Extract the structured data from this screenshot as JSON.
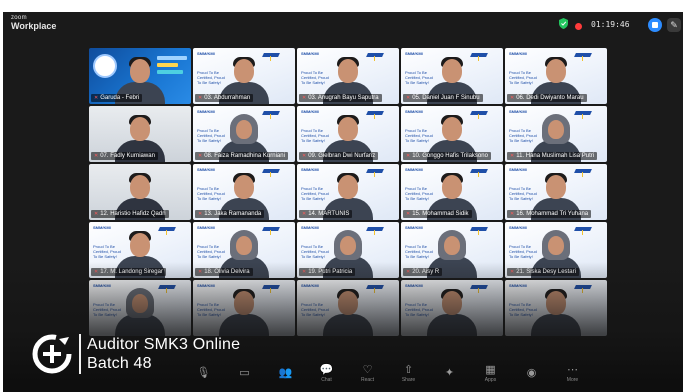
{
  "app": {
    "brand_small": "zoom",
    "brand_big": "Workplace"
  },
  "status": {
    "timer": "01:19:46"
  },
  "tile_brand": "SMM/KMI",
  "tile_slogan": "Proud To Be Certified, Proud To Be Safety!",
  "participants": [
    {
      "name": "Garuda - Febri",
      "kind": "host"
    },
    {
      "name": "03. Abdurrahman",
      "kind": "bg"
    },
    {
      "name": "03. Anugrah Bayu Saputra",
      "kind": "bg"
    },
    {
      "name": "05. Daniel Juan F Sinubu",
      "kind": "bg"
    },
    {
      "name": "06. Dedi Dwiyanto Marau",
      "kind": "bg"
    },
    {
      "name": "07. Fadly Kurniawan",
      "kind": "plain"
    },
    {
      "name": "08. Faiza Ramadhina Kurniani",
      "kind": "bg",
      "hijab": true
    },
    {
      "name": "09. Gielbran Dwi Nurfariz",
      "kind": "bg"
    },
    {
      "name": "10. Gonggo Hafis Trilaksono",
      "kind": "bg"
    },
    {
      "name": "11. Hana Muslimah Lisa Putri",
      "kind": "bg",
      "hijab": true
    },
    {
      "name": "12. Haristio Hafidz Qadri",
      "kind": "plain"
    },
    {
      "name": "13. Jaka Ramananda",
      "kind": "bg"
    },
    {
      "name": "14. MARTUNIS",
      "kind": "bg"
    },
    {
      "name": "15. Mohammad Sidik",
      "kind": "bg"
    },
    {
      "name": "16. Mohammad Tri Yuhana",
      "kind": "bg"
    },
    {
      "name": "17. M. Landong Siregar",
      "kind": "bg"
    },
    {
      "name": "18. Olivia Delvira",
      "kind": "bg",
      "hijab": true
    },
    {
      "name": "19. Putri Patricia",
      "kind": "bg",
      "hijab": true
    },
    {
      "name": "20. Aisy R",
      "kind": "bg",
      "hijab": true
    },
    {
      "name": "21. Siska Desy Lestari",
      "kind": "bg",
      "hijab": true
    },
    {
      "name": "",
      "kind": "bg",
      "hijab": true
    },
    {
      "name": "",
      "kind": "bg"
    },
    {
      "name": "",
      "kind": "bg"
    },
    {
      "name": "",
      "kind": "bg"
    },
    {
      "name": "",
      "kind": "bg"
    }
  ],
  "toolbar": [
    {
      "icon": "mic-icon",
      "glyph": "🎙",
      "label": ""
    },
    {
      "icon": "video-icon",
      "glyph": "▭",
      "label": ""
    },
    {
      "icon": "participants-icon",
      "glyph": "👥",
      "label": ""
    },
    {
      "icon": "chat-icon",
      "glyph": "💬",
      "label": "Chat"
    },
    {
      "icon": "react-icon",
      "glyph": "♡",
      "label": "React"
    },
    {
      "icon": "share-icon",
      "glyph": "⇧",
      "label": "Share"
    },
    {
      "icon": "host-tools-icon",
      "glyph": "✦",
      "label": ""
    },
    {
      "icon": "apps-icon",
      "glyph": "▦",
      "label": "Apps"
    },
    {
      "icon": "record-icon",
      "glyph": "◉",
      "label": ""
    },
    {
      "icon": "more-icon",
      "glyph": "⋯",
      "label": "More"
    }
  ],
  "overlay": {
    "line1": "Auditor SMK3 Online",
    "line2": "Batch 48"
  },
  "colors": {
    "accent": "#2d8cff",
    "recording": "#ff3b3b",
    "overlay_text": "#ffffff"
  }
}
